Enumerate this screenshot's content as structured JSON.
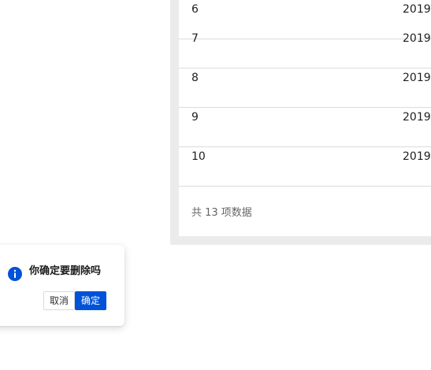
{
  "table": {
    "rows": [
      {
        "id": "6",
        "date": "2019-"
      },
      {
        "id": "7",
        "date": "2019-"
      },
      {
        "id": "8",
        "date": "2019-"
      },
      {
        "id": "9",
        "date": "2019-"
      },
      {
        "id": "10",
        "date": "2019-"
      }
    ]
  },
  "pagination": {
    "total_text": "共 13 项数据"
  },
  "popconfirm": {
    "title": "你确定要删除吗",
    "cancel_label": "取消",
    "confirm_label": "确定",
    "icon": "info-icon",
    "icon_color": "#0052d9"
  },
  "colors": {
    "primary": "#0052d9",
    "panel_bg": "#ebebeb"
  }
}
